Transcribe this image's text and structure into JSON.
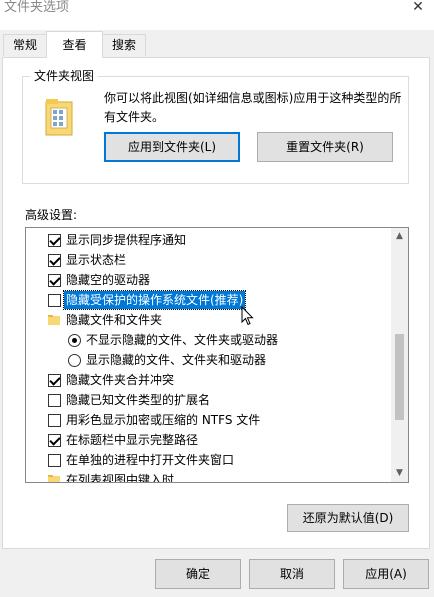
{
  "window": {
    "title": "文件夹选项",
    "close_glyph": "✕"
  },
  "tabs": [
    {
      "label": "常规",
      "active": false
    },
    {
      "label": "查看",
      "active": true
    },
    {
      "label": "搜索",
      "active": false
    }
  ],
  "folder_view": {
    "title": "文件夹视图",
    "description": "你可以将此视图(如详细信息或图标)应用于这种类型的所有文件夹。",
    "apply_label": "应用到文件夹(L)",
    "reset_label": "重置文件夹(R)"
  },
  "advanced": {
    "label": "高级设置:",
    "items": [
      {
        "type": "checkbox",
        "checked": true,
        "label": "显示同步提供程序通知"
      },
      {
        "type": "checkbox",
        "checked": true,
        "label": "显示状态栏"
      },
      {
        "type": "checkbox",
        "checked": true,
        "label": "隐藏空的驱动器"
      },
      {
        "type": "checkbox",
        "checked": false,
        "label": "隐藏受保护的操作系统文件(推荐)",
        "selected": true
      },
      {
        "type": "folder",
        "label": "隐藏文件和文件夹"
      },
      {
        "type": "radio",
        "checked": true,
        "label": "不显示隐藏的文件、文件夹或驱动器"
      },
      {
        "type": "radio",
        "checked": false,
        "label": "显示隐藏的文件、文件夹和驱动器"
      },
      {
        "type": "checkbox",
        "checked": true,
        "label": "隐藏文件夹合并冲突"
      },
      {
        "type": "checkbox",
        "checked": false,
        "label": "隐藏已知文件类型的扩展名"
      },
      {
        "type": "checkbox",
        "checked": false,
        "label": "用彩色显示加密或压缩的 NTFS 文件"
      },
      {
        "type": "checkbox",
        "checked": true,
        "label": "在标题栏中显示完整路径"
      },
      {
        "type": "checkbox",
        "checked": false,
        "label": "在单独的进程中打开文件夹窗口"
      },
      {
        "type": "folder",
        "label": "在列表视图中键入时"
      }
    ],
    "restore_label": "还原为默认值(D)"
  },
  "footer": {
    "ok_label": "确定",
    "cancel_label": "取消",
    "apply_label": "应用(A)"
  },
  "colors": {
    "selection": "#0078d7",
    "folder": "#f8d775",
    "button_bg": "#e1e1e1"
  }
}
